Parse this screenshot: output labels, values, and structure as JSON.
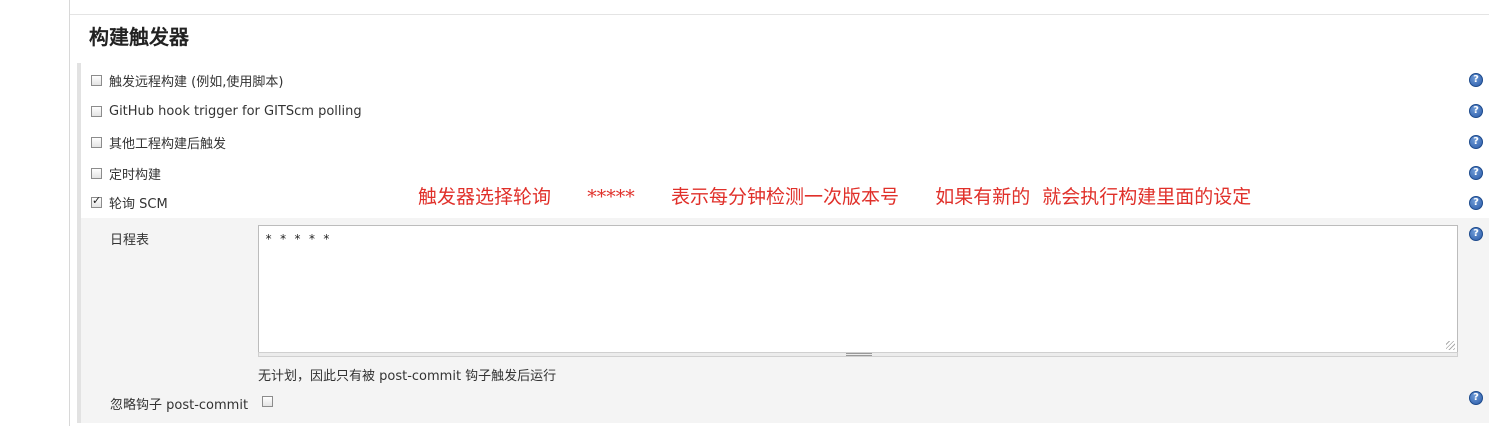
{
  "section": {
    "title": "构建触发器"
  },
  "triggers": [
    {
      "label": "触发远程构建 (例如,使用脚本)",
      "checked": false
    },
    {
      "label": "GitHub hook trigger for GITScm polling",
      "checked": false
    },
    {
      "label": "其他工程构建后触发",
      "checked": false
    },
    {
      "label": "定时构建",
      "checked": false
    },
    {
      "label": "轮询 SCM",
      "checked": true
    }
  ],
  "annotation": {
    "text": "触发器选择轮询      *****      表示每分钟检测一次版本号      如果有新的  就会执行构建里面的设定",
    "color": "#e0302a"
  },
  "schedule": {
    "label": "日程表",
    "value": "* * * * *",
    "hint": "无计划，因此只有被 post-commit 钩子触发后运行"
  },
  "ignore_post_commit": {
    "label": "忽略钩子 post-commit",
    "checked": false
  },
  "help": {
    "glyph": "?",
    "icon": "help-icon"
  }
}
